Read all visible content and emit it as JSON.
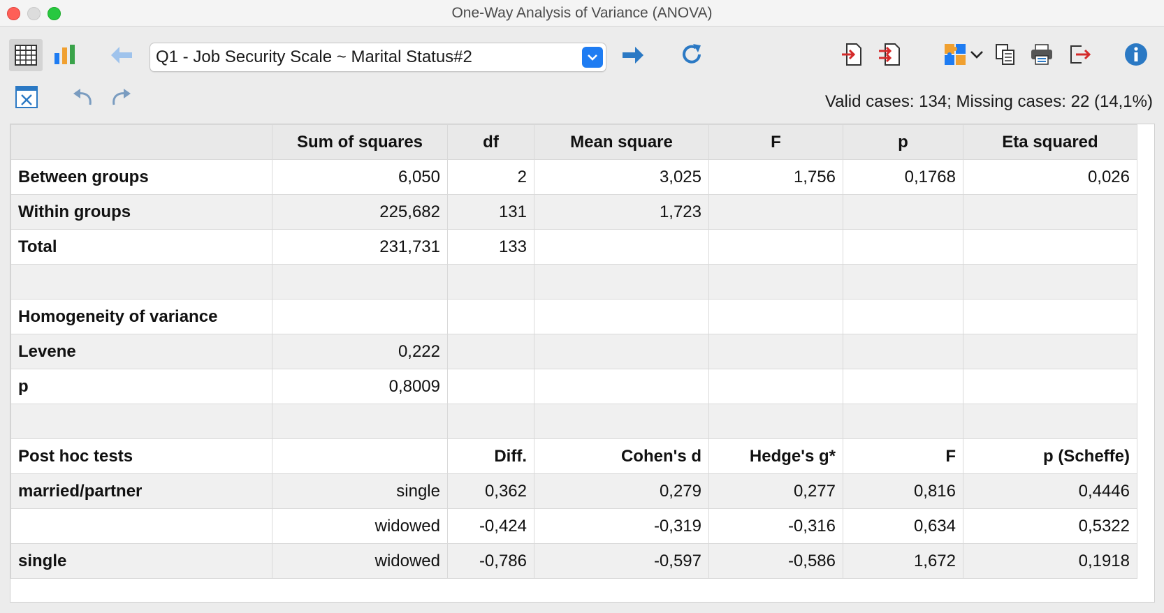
{
  "window": {
    "title": "One-Way Analysis of Variance (ANOVA)"
  },
  "toolbar": {
    "variable_selector": "Q1 - Job Security Scale ~ Marital Status#2",
    "icons": [
      "table-view-icon",
      "chart-view-icon",
      "back-arrow-icon",
      "dropdown-arrow-icon",
      "forward-arrow-icon",
      "refresh-icon",
      "export-icon",
      "export-all-icon",
      "puzzle-icon",
      "chevron-down-icon",
      "copy-icon",
      "print-icon",
      "exit-icon",
      "info-icon",
      "close-table-icon",
      "undo-icon",
      "redo-icon"
    ]
  },
  "status": {
    "text": "Valid cases: 134;  Missing cases: 22 (14,1%)"
  },
  "table": {
    "headers": [
      "",
      "Sum of squares",
      "df",
      "Mean square",
      "F",
      "p",
      "Eta squared"
    ],
    "rows": [
      [
        "Between groups",
        "6,050",
        "2",
        "3,025",
        "1,756",
        "0,1768",
        "0,026"
      ],
      [
        "Within groups",
        "225,682",
        "131",
        "1,723",
        "",
        "",
        ""
      ],
      [
        "Total",
        "231,731",
        "133",
        "",
        "",
        "",
        ""
      ],
      [
        "",
        "",
        "",
        "",
        "",
        "",
        ""
      ],
      [
        "Homogeneity of variance",
        "",
        "",
        "",
        "",
        "",
        ""
      ],
      [
        "Levene",
        "0,222",
        "",
        "",
        "",
        "",
        ""
      ],
      [
        "p",
        "0,8009",
        "",
        "",
        "",
        "",
        ""
      ],
      [
        "",
        "",
        "",
        "",
        "",
        "",
        ""
      ],
      [
        "Post hoc tests",
        "",
        "Diff.",
        "Cohen's d",
        "Hedge's g*",
        "F",
        "p (Scheffe)"
      ],
      [
        "married/partner",
        "single",
        "0,362",
        "0,279",
        "0,277",
        "0,816",
        "0,4446"
      ],
      [
        "",
        "widowed",
        "-0,424",
        "-0,319",
        "-0,316",
        "0,634",
        "0,5322"
      ],
      [
        "single",
        "widowed",
        "-0,786",
        "-0,597",
        "-0,586",
        "1,672",
        "0,1918"
      ]
    ]
  }
}
